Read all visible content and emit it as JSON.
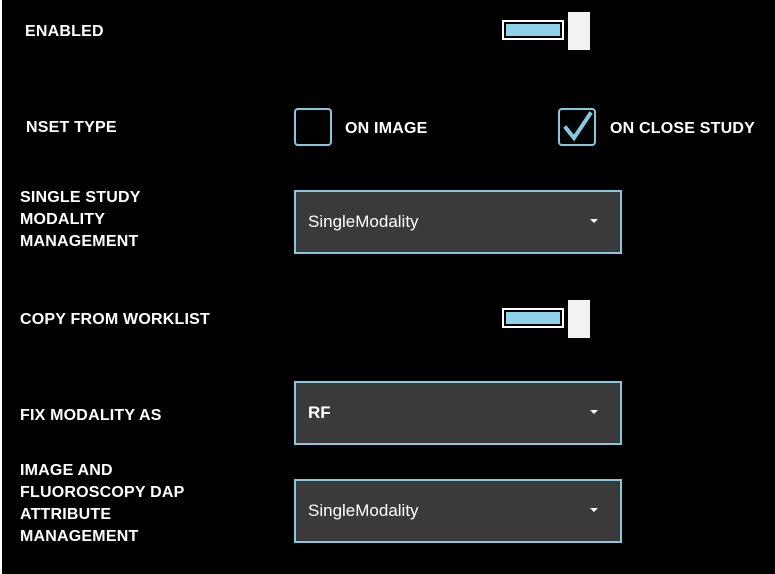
{
  "enabled": {
    "label": "ENABLED",
    "on": true
  },
  "nset_type": {
    "label": "NSET TYPE",
    "options": [
      {
        "label": "ON IMAGE",
        "checked": false
      },
      {
        "label": "ON CLOSE STUDY",
        "checked": true
      }
    ]
  },
  "single_study": {
    "label": "SINGLE STUDY\nMODALITY\nMANAGEMENT",
    "value": "SingleModality"
  },
  "copy_from_worklist": {
    "label": "COPY FROM WORKLIST",
    "on": true
  },
  "fix_modality": {
    "label": "FIX MODALITY AS",
    "value": "RF"
  },
  "dap_attribute": {
    "label": "IMAGE AND\nFLUOROSCOPY DAP\nATTRIBUTE\nMANAGEMENT",
    "value": "SingleModality"
  },
  "colors": {
    "accent": "#86c8e2",
    "toggle_fill": "#8fd0ea",
    "dropdown_bg": "#3a3a3a"
  }
}
